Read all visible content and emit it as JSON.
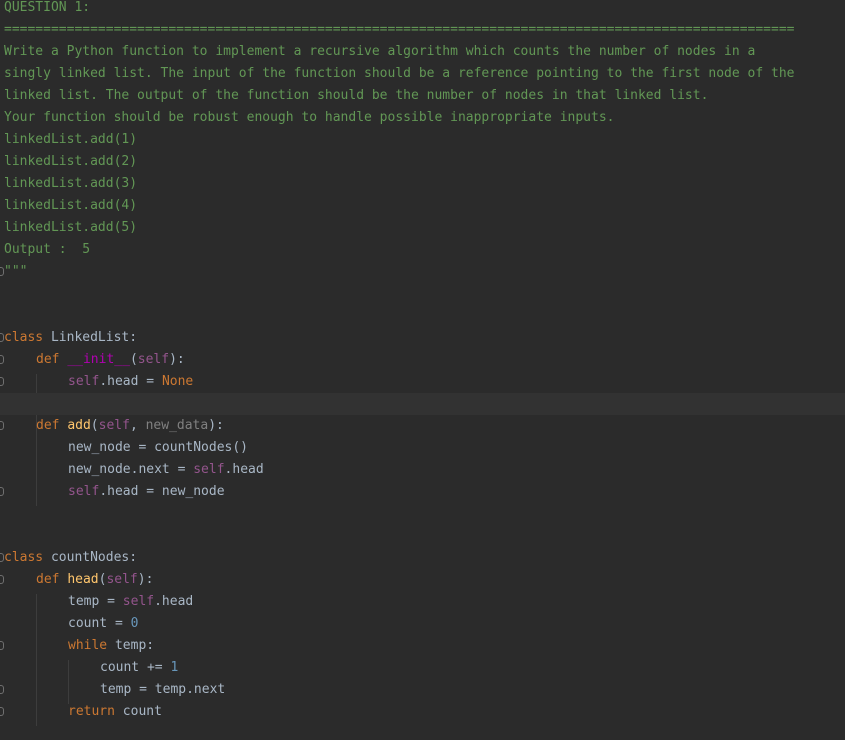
{
  "docstring": {
    "title": "QUESTION 1:",
    "rule": "=====================================================================================================",
    "line1": "Write a Python function to implement a recursive algorithm which counts the number of nodes in a",
    "line2": "singly linked list. The input of the function should be a reference pointing to the first node of the",
    "line3": "linked list. The output of the function should be the number of nodes in that linked list.",
    "line4": "Your function should be robust enough to handle possible inappropriate inputs.",
    "ex1": "linkedList.add(1)",
    "ex2": "linkedList.add(2)",
    "ex3": "linkedList.add(3)",
    "ex4": "linkedList.add(4)",
    "ex5": "linkedList.add(5)",
    "output": "Output :  5",
    "close": "\"\"\""
  },
  "code": {
    "kw_class": "class",
    "kw_def": "def",
    "kw_while": "while",
    "kw_return": "return",
    "none": "None",
    "self": "self",
    "class1_name": " LinkedList:",
    "init_name": "__init__",
    "open_paren": "(",
    "close_paren_colon": "):",
    "head_assign": ".head = ",
    "add_name": "add",
    "comma_space": ", ",
    "new_data": "new_data",
    "new_node_assign": "new_node = countNodes()",
    "new_node_next": "new_node.next = ",
    "dot_head": ".head",
    "head_eq_new_node": ".head = new_node",
    "class2_name": " countNodes:",
    "head_name": "head",
    "temp_assign": "temp = ",
    "count_assign": "count = ",
    "zero": "0",
    "while_cond": " temp:",
    "count_incr": "count += ",
    "one": "1",
    "temp_next": "temp = temp.next",
    "return_val": " count"
  }
}
